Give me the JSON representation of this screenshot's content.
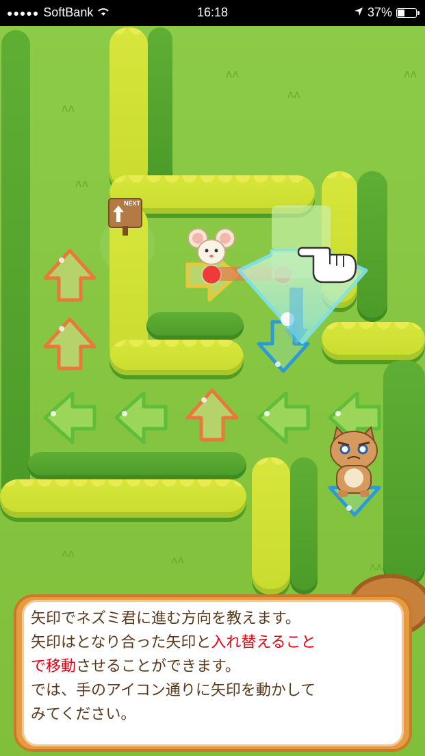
{
  "status_bar": {
    "carrier": "SoftBank",
    "signal_dots": "●●●●●",
    "time": "16:18",
    "battery_percent": "37%",
    "battery_level": 0.37
  },
  "board": {
    "next_sign_text": "NEXT",
    "arrow_tiles": [
      {
        "direction": "up",
        "color": "orange"
      },
      {
        "direction": "up",
        "color": "orange"
      },
      {
        "direction": "left",
        "color": "green"
      },
      {
        "direction": "left",
        "color": "green"
      },
      {
        "direction": "up",
        "color": "orange"
      },
      {
        "direction": "left",
        "color": "green"
      },
      {
        "direction": "left",
        "color": "green"
      },
      {
        "direction": "right",
        "color": "yellow"
      },
      {
        "direction": "down",
        "color": "blue"
      },
      {
        "direction": "down",
        "color": "blue"
      }
    ],
    "characters": [
      "mouse-character",
      "cat-character"
    ],
    "colors": {
      "grass": "#8cc63f",
      "hedge": "#d3e23a",
      "dot": "#ef3a3a",
      "dialog_border": "#e79b3f",
      "highlight_text": "#e60012"
    }
  },
  "dialog": {
    "line1": "矢印でネズミ君に進む方向を教えます。",
    "line2_a": "矢印はとなり合った矢印と",
    "line2_b": "入れ替えること",
    "line3_a": "で移動",
    "line3_b": "させることができます。",
    "line4": "では、手のアイコン通りに矢印を動かして",
    "line5": "みてください。"
  }
}
